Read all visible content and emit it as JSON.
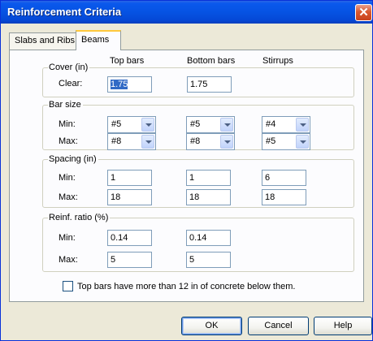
{
  "window": {
    "title": "Reinforcement Criteria",
    "close_glyph": "✕"
  },
  "tabs": [
    {
      "label": "Slabs and Ribs"
    },
    {
      "label": "Beams"
    }
  ],
  "columns": {
    "top": "Top bars",
    "bottom": "Bottom bars",
    "stirrups": "Stirrups"
  },
  "cover": {
    "label": "Cover (in)",
    "clear_label": "Clear:",
    "top": "1.75",
    "bottom": "1.75"
  },
  "bar_size": {
    "label": "Bar size",
    "min_label": "Min:",
    "max_label": "Max:",
    "min": {
      "top": "#5",
      "bottom": "#5",
      "stirrups": "#4"
    },
    "max": {
      "top": "#8",
      "bottom": "#8",
      "stirrups": "#5"
    }
  },
  "spacing": {
    "label": "Spacing (in)",
    "min_label": "Min:",
    "max_label": "Max:",
    "min": {
      "top": "1",
      "bottom": "1",
      "stirrups": "6"
    },
    "max": {
      "top": "18",
      "bottom": "18",
      "stirrups": "18"
    }
  },
  "reinf_ratio": {
    "label": "Reinf. ratio (%)",
    "min_label": "Min:",
    "max_label": "Max:",
    "min": {
      "top": "0.14",
      "bottom": "0.14"
    },
    "max": {
      "top": "5",
      "bottom": "5"
    }
  },
  "checkbox": {
    "label": "Top bars have more than 12 in of concrete below them.",
    "checked": false
  },
  "buttons": {
    "ok": "OK",
    "cancel": "Cancel",
    "help": "Help"
  },
  "colors": {
    "titlebar": "#0653e3",
    "close": "#d9582f",
    "dialog_bg": "#ece9d8",
    "panel_bg": "#fcfcfe",
    "selection": "#316ac5",
    "tab_highlight": "#ffc83c"
  },
  "icons": {
    "close": "close-icon",
    "dropdown": "chevron-down-icon"
  }
}
